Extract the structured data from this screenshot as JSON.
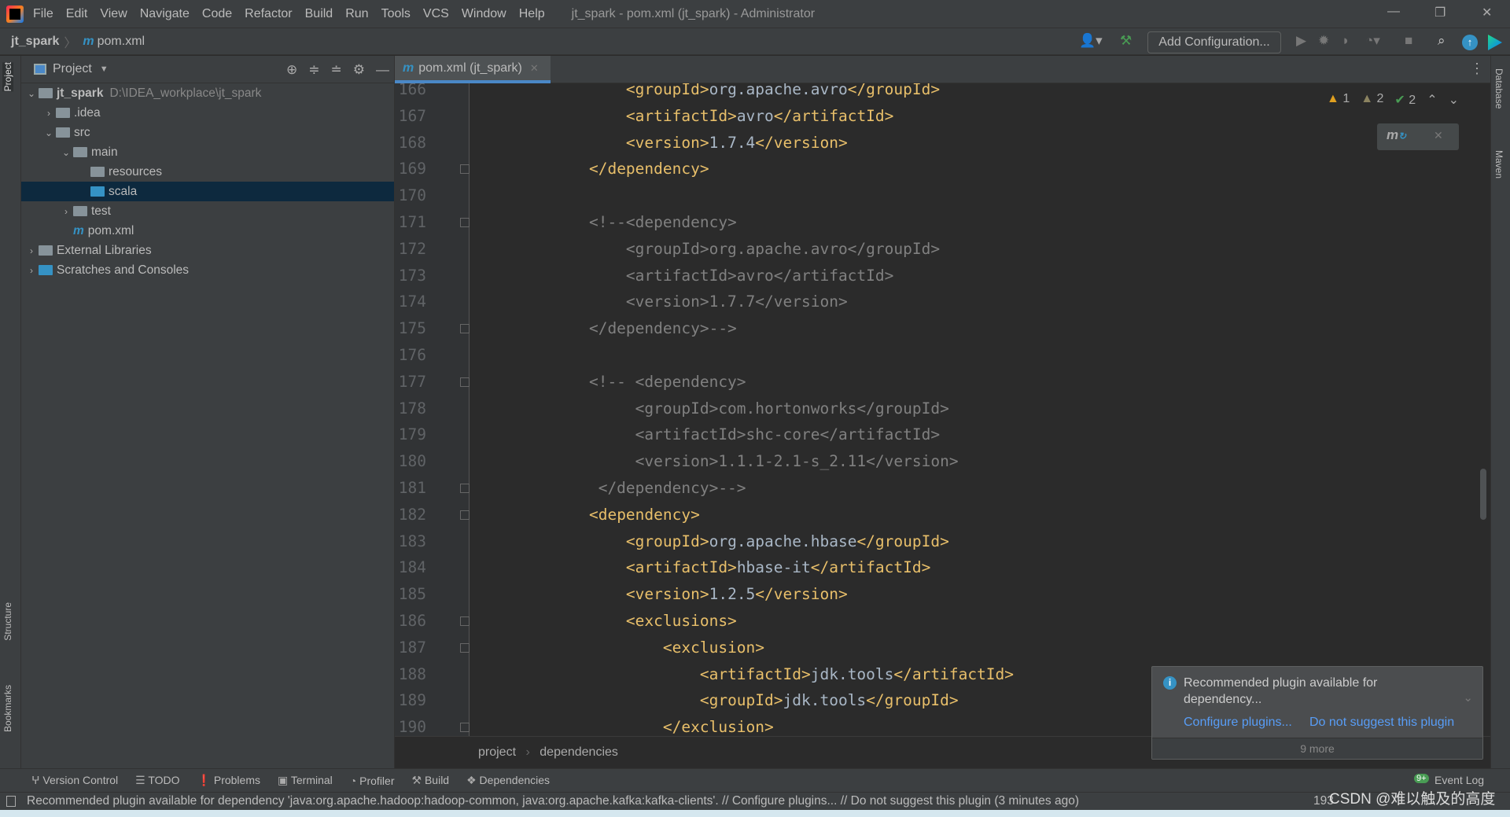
{
  "window": {
    "title": "jt_spark - pom.xml (jt_spark) - Administrator",
    "menu": [
      "File",
      "Edit",
      "View",
      "Navigate",
      "Code",
      "Refactor",
      "Build",
      "Run",
      "Tools",
      "VCS",
      "Window",
      "Help"
    ]
  },
  "navbar": {
    "project": "jt_spark",
    "file": "pom.xml",
    "file_icon": "m"
  },
  "toolbar": {
    "add_configuration": "Add Configuration..."
  },
  "left_stripe": {
    "project": "Project",
    "structure": "Structure",
    "bookmarks": "Bookmarks"
  },
  "right_stripe": {
    "database": "Database",
    "maven": "Maven"
  },
  "project_panel": {
    "title": "Project",
    "tree": [
      {
        "label": "jt_spark",
        "path": "D:\\IDEA_workplace\\jt_spark",
        "depth": 0,
        "arrow": "open",
        "icon": "folder",
        "bold": true
      },
      {
        "label": ".idea",
        "depth": 1,
        "arrow": "closed",
        "icon": "folder"
      },
      {
        "label": "src",
        "depth": 1,
        "arrow": "open",
        "icon": "folder"
      },
      {
        "label": "main",
        "depth": 2,
        "arrow": "open",
        "icon": "folder"
      },
      {
        "label": "resources",
        "depth": 3,
        "arrow": "none",
        "icon": "resources-folder"
      },
      {
        "label": "scala",
        "depth": 3,
        "arrow": "none",
        "icon": "source-folder",
        "selected": true
      },
      {
        "label": "test",
        "depth": 2,
        "arrow": "closed",
        "icon": "folder"
      },
      {
        "label": "pom.xml",
        "depth": 2,
        "arrow": "none",
        "icon": "maven-file"
      },
      {
        "label": "External Libraries",
        "depth": 0,
        "arrow": "closed",
        "icon": "library"
      },
      {
        "label": "Scratches and Consoles",
        "depth": 0,
        "arrow": "closed",
        "icon": "scratches"
      }
    ]
  },
  "editor": {
    "tab": "pom.xml (jt_spark)",
    "inspections": {
      "warnings": "1",
      "weak_warnings": "2",
      "typos": "2"
    },
    "lines": [
      {
        "n": "166",
        "text": "        <groupId>org.apache.avro</groupId>"
      },
      {
        "n": "167",
        "text": "        <artifactId>avro</artifactId>"
      },
      {
        "n": "168",
        "text": "        <version>1.7.4</version>"
      },
      {
        "n": "169",
        "text": "    </dependency>",
        "fold": true
      },
      {
        "n": "170",
        "text": ""
      },
      {
        "n": "171",
        "text": "    <!--<dependency>",
        "comment": true,
        "fold": true
      },
      {
        "n": "172",
        "text": "        <groupId>org.apache.avro</groupId>",
        "comment": true
      },
      {
        "n": "173",
        "text": "        <artifactId>avro</artifactId>",
        "comment": true
      },
      {
        "n": "174",
        "text": "        <version>1.7.7</version>",
        "comment": true
      },
      {
        "n": "175",
        "text": "    </dependency>-->",
        "comment": true,
        "fold": true
      },
      {
        "n": "176",
        "text": ""
      },
      {
        "n": "177",
        "text": "    <!-- <dependency>",
        "comment": true,
        "fold": true
      },
      {
        "n": "178",
        "text": "         <groupId>com.hortonworks</groupId>",
        "comment": true
      },
      {
        "n": "179",
        "text": "         <artifactId>shc-core</artifactId>",
        "comment": true
      },
      {
        "n": "180",
        "text": "         <version>1.1.1-2.1-s_2.11</version>",
        "comment": true
      },
      {
        "n": "181",
        "text": "     </dependency>-->",
        "comment": true,
        "fold": true
      },
      {
        "n": "182",
        "text": "    <dependency>",
        "fold": true
      },
      {
        "n": "183",
        "text": "        <groupId>org.apache.hbase</groupId>"
      },
      {
        "n": "184",
        "text": "        <artifactId>hbase-it</artifactId>"
      },
      {
        "n": "185",
        "text": "        <version>1.2.5</version>"
      },
      {
        "n": "186",
        "text": "        <exclusions>",
        "fold": true
      },
      {
        "n": "187",
        "text": "            <exclusion>",
        "fold": true
      },
      {
        "n": "188",
        "text": "                <artifactId>jdk.tools</artifactId>"
      },
      {
        "n": "189",
        "text": "                <groupId>jdk.tools</groupId>"
      },
      {
        "n": "190",
        "text": "            </exclusion>",
        "fold": true
      }
    ],
    "breadcrumb": [
      "project",
      "dependencies"
    ]
  },
  "notification": {
    "message": "Recommended plugin available for dependency...",
    "configure": "Configure plugins...",
    "dismiss": "Do not suggest this plugin",
    "more": "9 more"
  },
  "tool_windows": [
    "Version Control",
    "TODO",
    "Problems",
    "Terminal",
    "Profiler",
    "Build",
    "Dependencies"
  ],
  "event_log": {
    "label": "Event Log",
    "badge": "9+"
  },
  "status": {
    "message": "Recommended plugin available for dependency 'java:org.apache.hadoop:hadoop-common, java:org.apache.kafka:kafka-clients'. // Configure plugins... // Do not suggest this plugin (3 minutes ago)",
    "position": "193",
    "watermark": "CSDN @难以触及的高度"
  },
  "colors": {
    "tag": "#e8bf6a",
    "text": "#a9b7c6",
    "comment": "#808080",
    "accent": "#4a88c7",
    "link": "#589df6"
  }
}
